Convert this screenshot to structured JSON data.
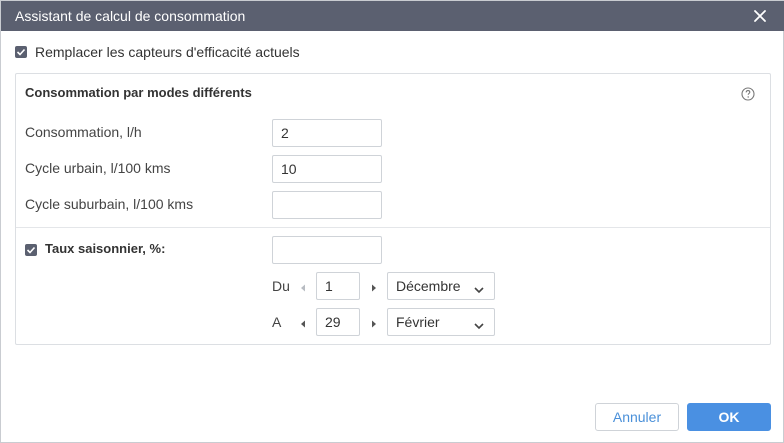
{
  "dialog": {
    "title": "Assistant de calcul de consommation"
  },
  "replace_sensors": {
    "checked": true,
    "label": "Remplacer les capteurs d'efficacité actuels"
  },
  "panel": {
    "title": "Consommation par modes différents",
    "rows": [
      {
        "label": "Consommation, l/h",
        "value": "2"
      },
      {
        "label": "Cycle urbain, l/100 kms",
        "value": "10"
      },
      {
        "label": "Cycle suburbain, l/100 kms",
        "value": ""
      }
    ],
    "seasonal": {
      "checked": true,
      "label": "Taux saisonnier, %:",
      "value": "",
      "from": {
        "label": "Du",
        "day": "1",
        "month": "Décembre"
      },
      "to": {
        "label": "A",
        "day": "29",
        "month": "Février"
      }
    }
  },
  "buttons": {
    "cancel": "Annuler",
    "ok": "OK"
  },
  "icons": {
    "close": "close-icon",
    "help": "help-icon",
    "check": "checkmark-icon",
    "arrow_left": "arrow-left-icon",
    "arrow_right": "arrow-right-icon",
    "chevron": "chevron-down-icon"
  },
  "colors": {
    "titlebar": "#5b6070",
    "primary": "#4a90e2",
    "link": "#4a90d9"
  }
}
